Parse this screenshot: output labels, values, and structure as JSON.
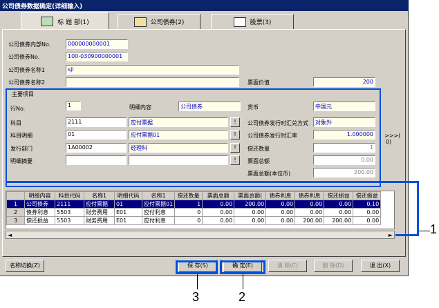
{
  "window": {
    "title": "公司债券数据确定(详细输入)"
  },
  "tabs": [
    {
      "label": "标 题 部(1)"
    },
    {
      "label": "公司债券(2)"
    },
    {
      "label": "股票(3)"
    }
  ],
  "header_fields": {
    "internal_no_label": "公司债券内部No.",
    "internal_no_value": "000000000001",
    "bond_no_label": "公司债券No.",
    "bond_no_value": "100-030900000001",
    "name1_label": "公司债券名称1",
    "name1_value": "sjl",
    "name2_label": "公司债券名称2",
    "name2_value": "",
    "face_value_label": "票面价值",
    "face_value_value": "200"
  },
  "main_item": {
    "group_label": "主要项目",
    "row_no_label": "行No.",
    "row_no_value": "1",
    "detail_label": "明细内容",
    "detail_value": "公司债券",
    "currency_label": "货币",
    "currency_value": "中国元",
    "account_label": "科目",
    "account_code": "2111",
    "account_name": "应付票据",
    "exch_method_label": "公司债券发行时汇兑方式",
    "exch_method_value": "对象外",
    "sub_account_label": "科目明细",
    "sub_account_code": "01",
    "sub_account_name": "应付票据01",
    "exch_rate_label": "公司债券发行时汇率",
    "exch_rate_value": "1.000000",
    "dept_label": "发行部门",
    "dept_code": "1A00002",
    "dept_name": "经理科",
    "repay_qty_label": "偿还数量",
    "repay_qty_value": "1",
    "memo_label": "明细摘要",
    "memo_value": "",
    "face_total_label": "票面总额",
    "face_total_value": "0.00",
    "face_total_local_label": "票面总额(本位币)",
    "face_total_local_value": "200.00",
    "pick_label": "!",
    "side_label_1": ">>>(",
    "side_label_2": "0)"
  },
  "grid": {
    "columns": [
      "明细内容",
      "科目代码",
      "名称1",
      "明细代码",
      "名称1",
      "偿还数量",
      "票面总额",
      "票面总额(",
      "债券利息",
      "债券利息",
      "偿还损益",
      "偿还损益"
    ],
    "rows": [
      {
        "n": "1",
        "cells": [
          "公司债券",
          "2111",
          "应付票据",
          "01",
          "应付票据01",
          "1",
          "0.00",
          "200.00",
          "0.00",
          "0.00",
          "0.00",
          "0.10"
        ]
      },
      {
        "n": "2",
        "cells": [
          "债券利息",
          "5503",
          "财务费用",
          "E01",
          "应付利息",
          "0",
          "0.00",
          "0.00",
          "0.00",
          "0.00",
          "0.00",
          "0.00"
        ]
      },
      {
        "n": "3",
        "cells": [
          "偿还损益",
          "5503",
          "财务费用",
          "E01",
          "应付利息",
          "0",
          "0.00",
          "0.00",
          "0.00",
          "200.00",
          "200.00",
          "0.00"
        ]
      }
    ]
  },
  "buttons": {
    "switch_name": "名称切换(Z)",
    "save": "保 存(S)",
    "confirm": "确 定(E)",
    "clear": "清 除(C)",
    "delete": "删 除(D)",
    "exit": "退 出(X)"
  },
  "callouts": {
    "c1": "1",
    "c2": "2",
    "c3": "3"
  },
  "colors": {
    "highlight": "#0050d8",
    "title_bg": "#0a246a",
    "selected_row": "#000080"
  }
}
